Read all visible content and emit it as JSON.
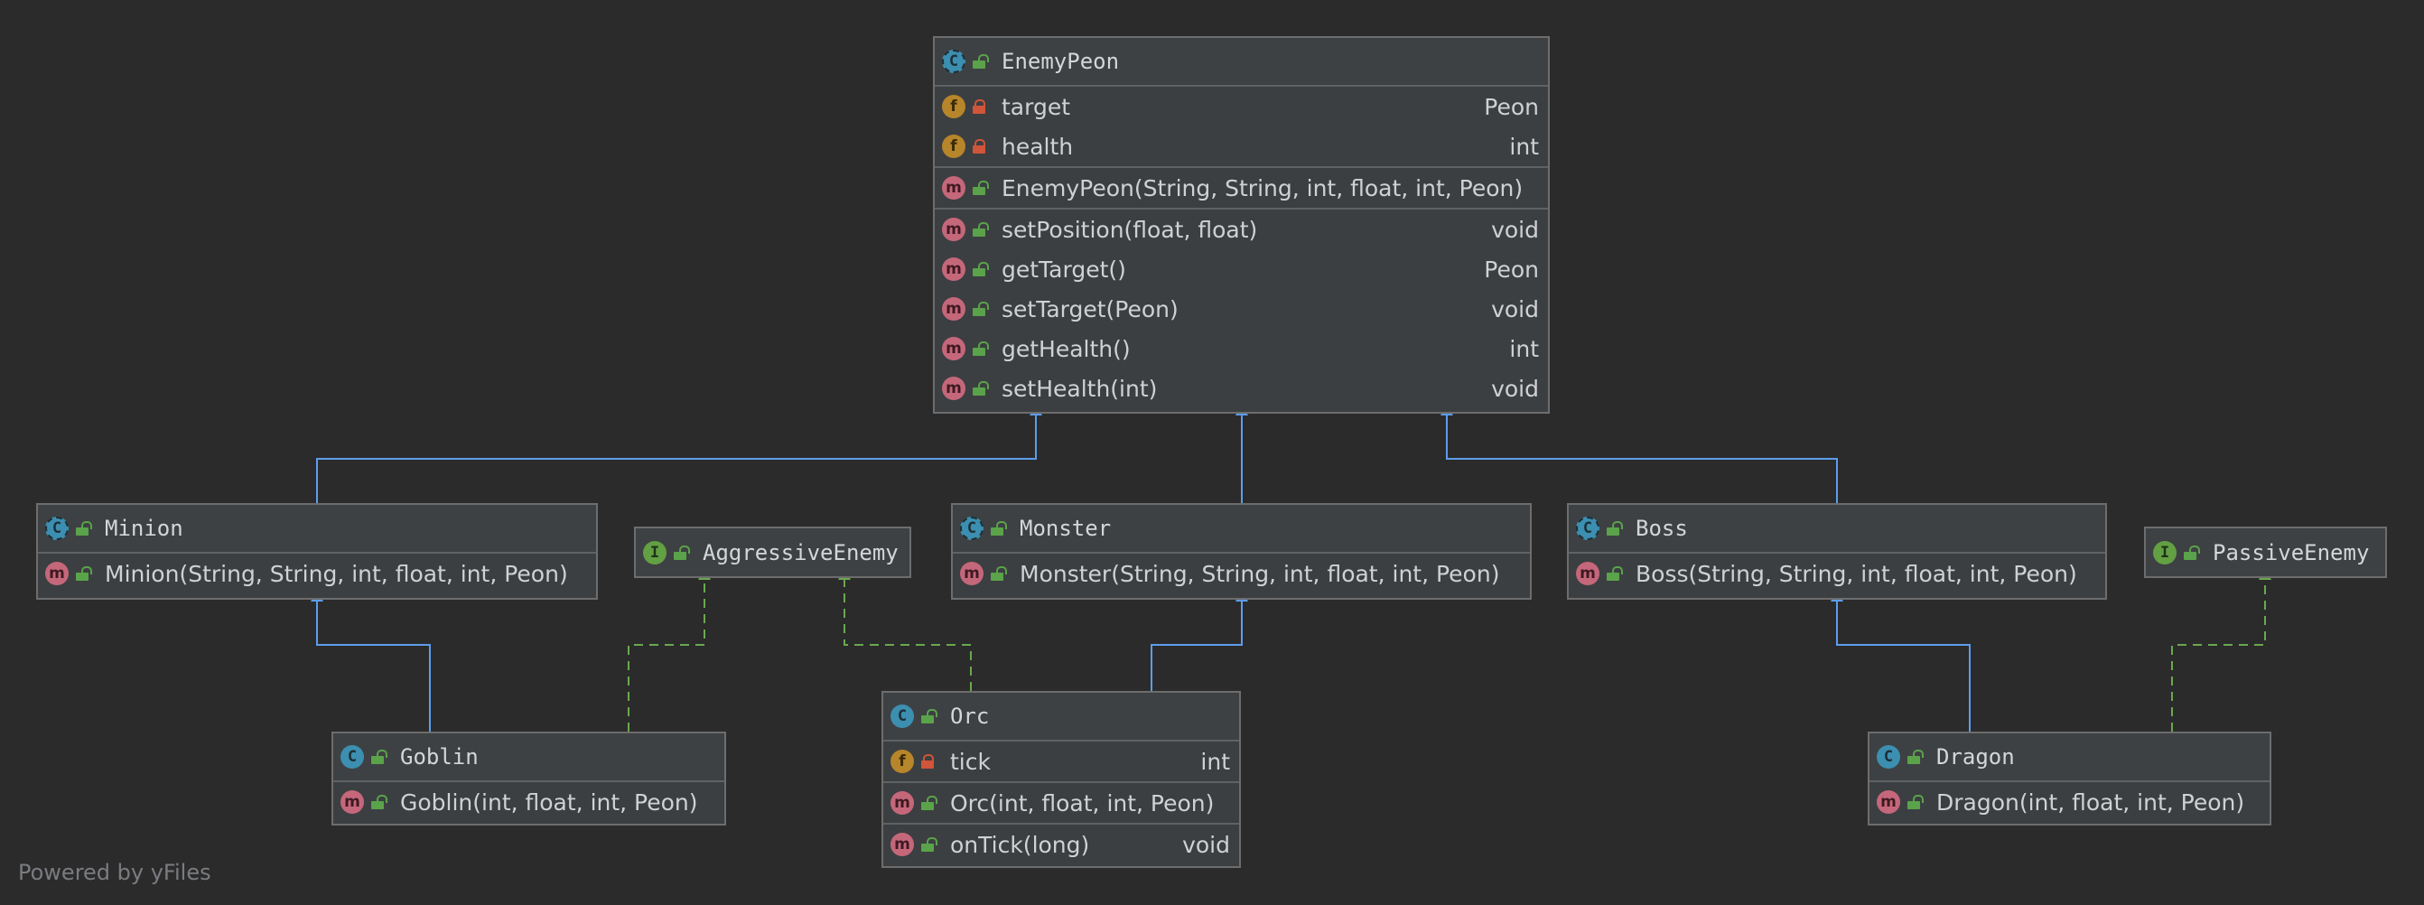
{
  "diagram": {
    "credit": "Powered by yFiles",
    "colors": {
      "background": "#2b2b2b",
      "extends_edge": "#5d9ded",
      "implements_edge": "#6aa84f"
    },
    "nodes": {
      "enemy_peon": {
        "name": "EnemyPeon",
        "kind": "abstract-class",
        "fields": [
          {
            "name": "target",
            "type": "Peon",
            "visibility": "private"
          },
          {
            "name": "health",
            "type": "int",
            "visibility": "private"
          }
        ],
        "constructors": [
          {
            "name": "EnemyPeon(String, String, int, float, int, Peon)",
            "type": ""
          }
        ],
        "methods": [
          {
            "name": "setPosition(float, float)",
            "type": "void"
          },
          {
            "name": "getTarget()",
            "type": "Peon"
          },
          {
            "name": "setTarget(Peon)",
            "type": "void"
          },
          {
            "name": "getHealth()",
            "type": "int"
          },
          {
            "name": "setHealth(int)",
            "type": "void"
          }
        ]
      },
      "minion": {
        "name": "Minion",
        "kind": "abstract-class",
        "constructors": [
          {
            "name": "Minion(String, String, int, float, int, Peon)",
            "type": ""
          }
        ]
      },
      "aggressive_enemy": {
        "name": "AggressiveEnemy",
        "kind": "interface"
      },
      "monster": {
        "name": "Monster",
        "kind": "abstract-class",
        "constructors": [
          {
            "name": "Monster(String, String, int, float, int, Peon)",
            "type": ""
          }
        ]
      },
      "boss": {
        "name": "Boss",
        "kind": "abstract-class",
        "constructors": [
          {
            "name": "Boss(String, String, int, float, int, Peon)",
            "type": ""
          }
        ]
      },
      "passive_enemy": {
        "name": "PassiveEnemy",
        "kind": "interface"
      },
      "goblin": {
        "name": "Goblin",
        "kind": "class",
        "constructors": [
          {
            "name": "Goblin(int, float, int, Peon)",
            "type": ""
          }
        ]
      },
      "orc": {
        "name": "Orc",
        "kind": "class",
        "fields": [
          {
            "name": "tick",
            "type": "int",
            "visibility": "private"
          }
        ],
        "constructors": [
          {
            "name": "Orc(int, float, int, Peon)",
            "type": ""
          }
        ],
        "methods": [
          {
            "name": "onTick(long)",
            "type": "void"
          }
        ]
      },
      "dragon": {
        "name": "Dragon",
        "kind": "class",
        "constructors": [
          {
            "name": "Dragon(int, float, int, Peon)",
            "type": ""
          }
        ]
      }
    },
    "edges": [
      {
        "from": "Minion",
        "to": "EnemyPeon",
        "relation": "extends"
      },
      {
        "from": "Monster",
        "to": "EnemyPeon",
        "relation": "extends"
      },
      {
        "from": "Boss",
        "to": "EnemyPeon",
        "relation": "extends"
      },
      {
        "from": "Goblin",
        "to": "Minion",
        "relation": "extends"
      },
      {
        "from": "Goblin",
        "to": "AggressiveEnemy",
        "relation": "implements"
      },
      {
        "from": "Orc",
        "to": "Monster",
        "relation": "extends"
      },
      {
        "from": "Orc",
        "to": "AggressiveEnemy",
        "relation": "implements"
      },
      {
        "from": "Dragon",
        "to": "Boss",
        "relation": "extends"
      },
      {
        "from": "Dragon",
        "to": "PassiveEnemy",
        "relation": "implements"
      }
    ]
  }
}
